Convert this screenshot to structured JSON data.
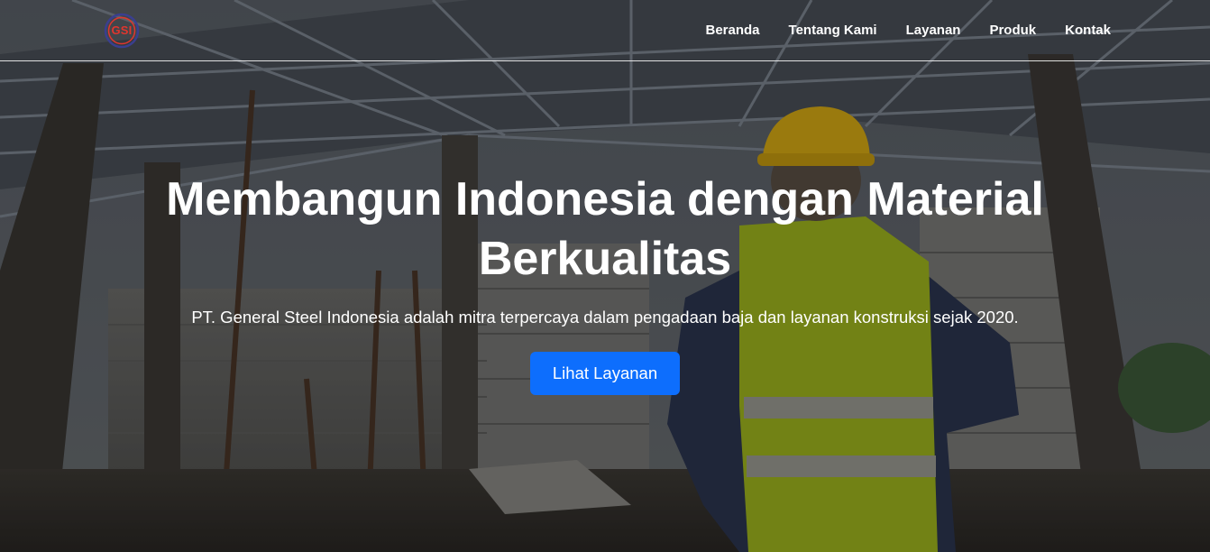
{
  "brand": {
    "logo_text": "GSI",
    "logo_color": "#e0362e",
    "logo_ring_color": "#3a3f8f"
  },
  "nav": {
    "items": [
      {
        "label": "Beranda"
      },
      {
        "label": "Tentang Kami"
      },
      {
        "label": "Layanan"
      },
      {
        "label": "Produk"
      },
      {
        "label": "Kontak"
      }
    ]
  },
  "hero": {
    "title": "Membangun Indonesia dengan Material Berkualitas",
    "subtitle": "PT. General Steel Indonesia adalah mitra terpercaya dalam pengadaan baja dan layanan konstruksi sejak 2020.",
    "cta_label": "Lihat Layanan",
    "cta_color": "#0d6efd",
    "background_image": "construction-site-steel-roof-frame-with-worker-in-hardhat-photo"
  }
}
